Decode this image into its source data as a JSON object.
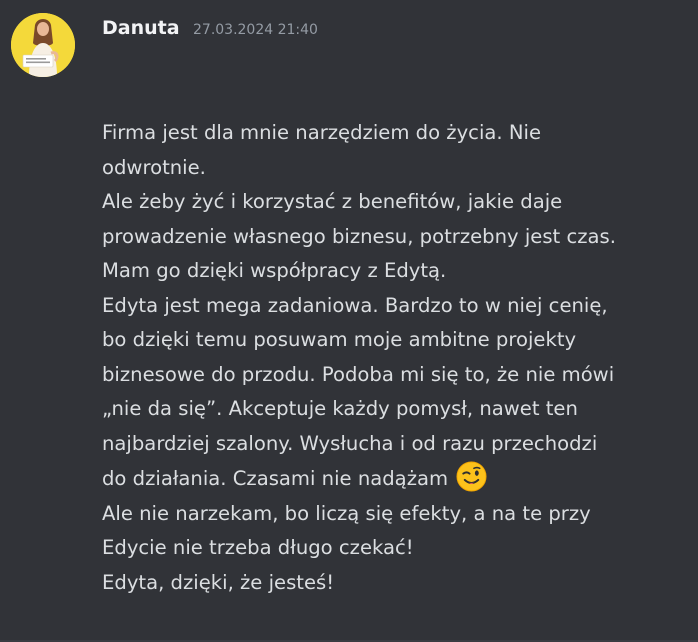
{
  "message": {
    "author": "Danuta",
    "timestamp": "27.03.2024 21:40",
    "avatar_icon": "user-avatar",
    "lines": [
      "Firma jest dla mnie narzędziem do życia. Nie",
      "odwrotnie.",
      "Ale żeby żyć i korzystać z benefitów, jakie daje",
      "prowadzenie własnego biznesu, potrzebny jest czas.",
      "Mam go dzięki współpracy z Edytą.",
      "Edyta jest mega zadaniowa. Bardzo to w niej cenię,",
      "bo dzięki temu posuwam moje ambitne projekty",
      "biznesowe do przodu. Podoba mi się to, że nie mówi",
      "„nie da się”. Akceptuje każdy pomysł, nawet ten",
      "najbardziej szalony. Wysłucha i od razu przechodzi",
      "do działania. Czasami nie nadążam",
      "Ale nie narzekam, bo liczą się efekty, a na te przy",
      "Edycie nie trzeba długo czekać!",
      "Edyta, dzięki, że jesteś!"
    ],
    "emoji_icon": "winking-face-emoji"
  },
  "colors": {
    "background": "#313338",
    "author": "#f2f3f5",
    "timestamp": "#949ba4",
    "text": "#dbdee1",
    "avatar_bg": "#f4d93a"
  }
}
